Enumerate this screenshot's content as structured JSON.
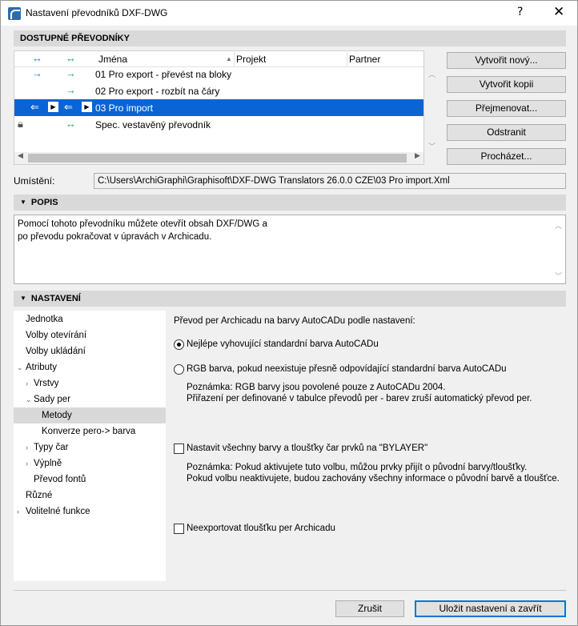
{
  "window": {
    "title": "Nastavení převodníků DXF-DWG",
    "help": "?",
    "close": "✕"
  },
  "translators": {
    "section_title": "DOSTUPNÉ PŘEVODNÍKY",
    "columns": {
      "name": "Jména",
      "project": "Projekt",
      "partner": "Partner"
    },
    "rows": [
      {
        "name": "01 Pro export - převést na bloky"
      },
      {
        "name": "02 Pro export - rozbít na čáry"
      },
      {
        "name": "03 Pro import"
      },
      {
        "name": "Spec. vestavěný převodník"
      }
    ],
    "buttons": {
      "new": "Vytvořit nový...",
      "copy": "Vytvořit kopii",
      "rename": "Přejmenovat...",
      "delete": "Odstranit",
      "browse": "Procházet..."
    }
  },
  "location": {
    "label": "Umístění:",
    "path": "C:\\Users\\ArchiGraphi\\Graphisoft\\DXF-DWG Translators 26.0.0 CZE\\03 Pro import.Xml"
  },
  "description": {
    "section_title": "POPIS",
    "line1": "Pomocí tohoto převodníku můžete otevřít obsah DXF/DWG a",
    "line2": "po převodu pokračovat v úpravách v Archicadu."
  },
  "settings": {
    "section_title": "NASTAVENÍ",
    "tree": [
      {
        "label": "Jednotka"
      },
      {
        "label": "Volby otevírání"
      },
      {
        "label": "Volby ukládání"
      },
      {
        "label": "Atributy"
      },
      {
        "label": "Vrstvy"
      },
      {
        "label": "Sady per"
      },
      {
        "label": "Metody"
      },
      {
        "label": "Konverze pero-> barva"
      },
      {
        "label": "Typy čar"
      },
      {
        "label": "Výplně"
      },
      {
        "label": "Převod fontů"
      },
      {
        "label": "Různé"
      },
      {
        "label": "Volitelné funkce"
      }
    ],
    "panel": {
      "heading": "Převod per Archicadu na barvy AutoCADu podle nastavení:",
      "radio1": "Nejlépe vyhovující standardní barva AutoCADu",
      "radio2": "RGB barva, pokud neexistuje přesně odpovídající standardní barva AutoCADu",
      "note1_line1": "Poznámka: RGB barvy jsou povolené pouze z AutoCADu 2004.",
      "note1_line2": "Přiřazení per definované v tabulce převodů per - barev zruší automatický převod per.",
      "check1": "Nastavit všechny barvy a tloušťky čar prvků na \"BYLAYER\"",
      "note2_line1": "Poznámka: Pokud aktivujete tuto volbu, můžou prvky přijít o původní barvy/tloušťky.",
      "note2_line2": "Pokud volbu neaktivujete, budou zachovány všechny informace o původní barvě a tloušťce.",
      "check2": "Neexportovat tloušťku per Archicadu"
    }
  },
  "footer": {
    "cancel": "Zrušit",
    "save": "Uložit nastavení a zavřít"
  }
}
